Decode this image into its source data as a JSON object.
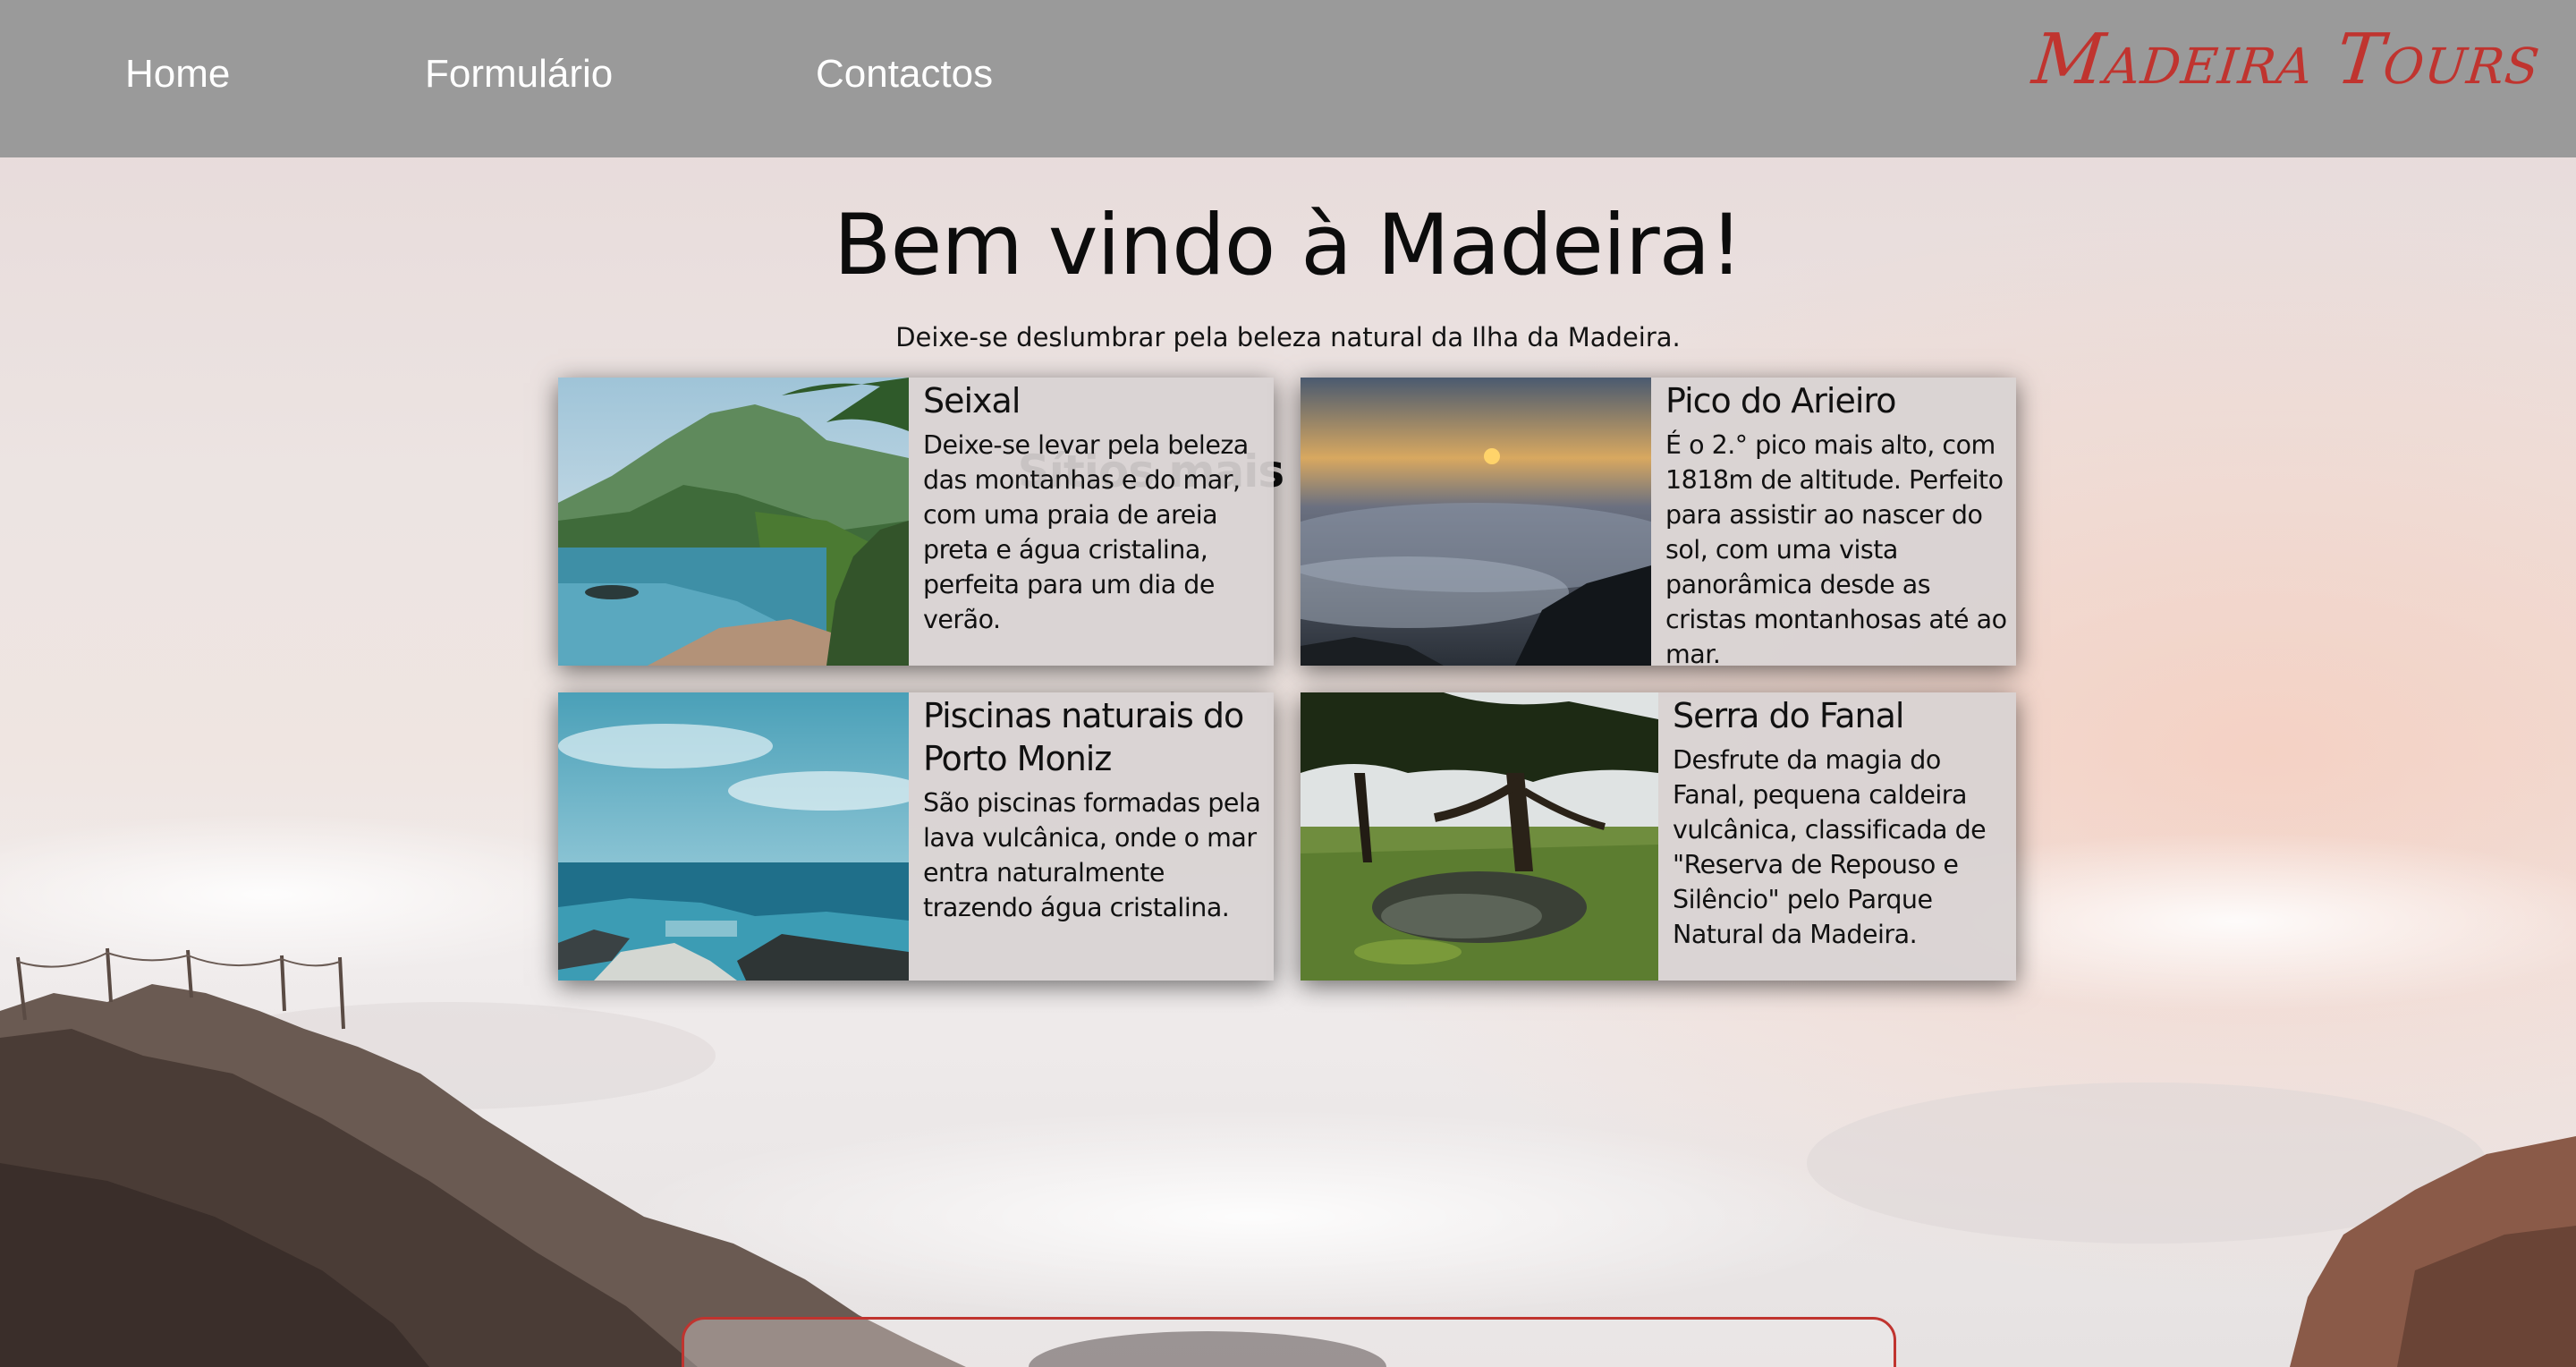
{
  "nav": {
    "home": "Home",
    "form": "Formulário",
    "contact": "Contactos",
    "brand": "Madeira Tours"
  },
  "hero": {
    "title": "Bem vindo à Madeira!",
    "subtitle": "Deixe-se deslumbrar pela beleza natural da Ilha da Madeira."
  },
  "popular": {
    "title": "Sítios mais populares:",
    "cards": [
      {
        "title": "Seixal",
        "description": "Deixe-se levar pela beleza das montanhas e do mar, com uma praia de areia preta e água cristalina, perfeita para um dia de verão."
      },
      {
        "title": "Pico do Arieiro",
        "description": "É o 2.° pico mais alto, com 1818m de altitude. Perfeito para assistir ao nascer do sol, com uma vista panorâmica desde as cristas montanhosas até ao mar."
      },
      {
        "title": "Piscinas naturais do Porto Moniz",
        "description": "São piscinas formadas pela lava vulcânica, onde o mar entra naturalmente trazendo água cristalina."
      },
      {
        "title": "Serra do Fanal",
        "description": "Desfrute da magia do Fanal, pequena caldeira vulcânica, classificada de \"Reserva de Repouso e Silêncio\" pelo Parque Natural da Madeira."
      }
    ]
  },
  "colors": {
    "navbar": "#9a9a9a",
    "brand": "#c0342f",
    "card_bg": "#d8d2d2"
  }
}
